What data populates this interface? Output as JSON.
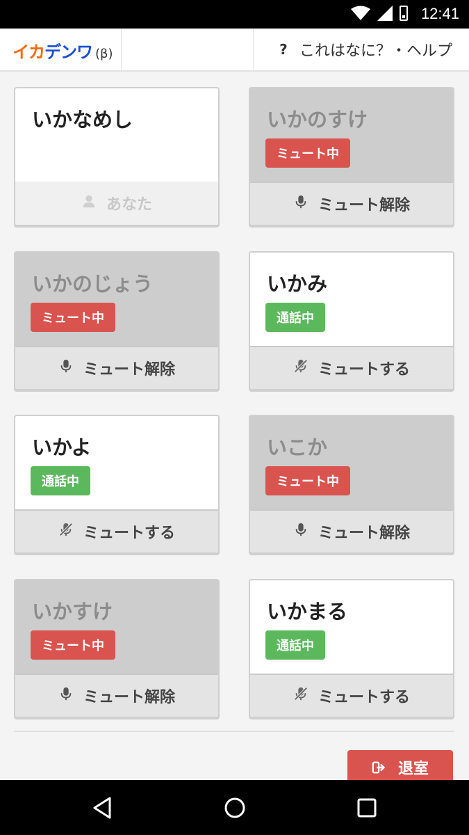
{
  "status_bar": {
    "time": "12:41",
    "icons": [
      "wifi-icon",
      "cell-signal-icon",
      "battery-icon"
    ]
  },
  "header": {
    "brand_ika": "イカ",
    "brand_denwa": "デンワ",
    "brand_beta": "(β)",
    "help_icon": "?",
    "help_label": "これはなに？・ヘルプ"
  },
  "colors": {
    "brand_orange": "#f26b0d",
    "brand_blue": "#1a4fd3",
    "mute_red": "#d9534f",
    "talk_green": "#5cb85c",
    "muted_card_bg": "#cdcdcd"
  },
  "members": [
    {
      "name": "いかなめし",
      "status": "",
      "action": "あなた",
      "action_icon": "user-icon",
      "muted": false,
      "self": true
    },
    {
      "name": "いかのすけ",
      "status": "ミュート中",
      "action": "ミュート解除",
      "action_icon": "microphone-icon",
      "muted": true,
      "self": false
    },
    {
      "name": "いかのじょう",
      "status": "ミュート中",
      "action": "ミュート解除",
      "action_icon": "microphone-icon",
      "muted": true,
      "self": false
    },
    {
      "name": "いかみ",
      "status": "通話中",
      "action": "ミュートする",
      "action_icon": "microphone-slash-icon",
      "muted": false,
      "self": false
    },
    {
      "name": "いかよ",
      "status": "通話中",
      "action": "ミュートする",
      "action_icon": "microphone-slash-icon",
      "muted": false,
      "self": false
    },
    {
      "name": "いこか",
      "status": "ミュート中",
      "action": "ミュート解除",
      "action_icon": "microphone-icon",
      "muted": true,
      "self": false
    },
    {
      "name": "いかすけ",
      "status": "ミュート中",
      "action": "ミュート解除",
      "action_icon": "microphone-icon",
      "muted": true,
      "self": false
    },
    {
      "name": "いかまる",
      "status": "通話中",
      "action": "ミュートする",
      "action_icon": "microphone-slash-icon",
      "muted": false,
      "self": false
    }
  ],
  "leave_button": {
    "label": "退室",
    "icon": "sign-out-icon"
  },
  "nav_bar": {
    "icons": [
      "back-icon",
      "home-icon",
      "recents-icon"
    ]
  }
}
